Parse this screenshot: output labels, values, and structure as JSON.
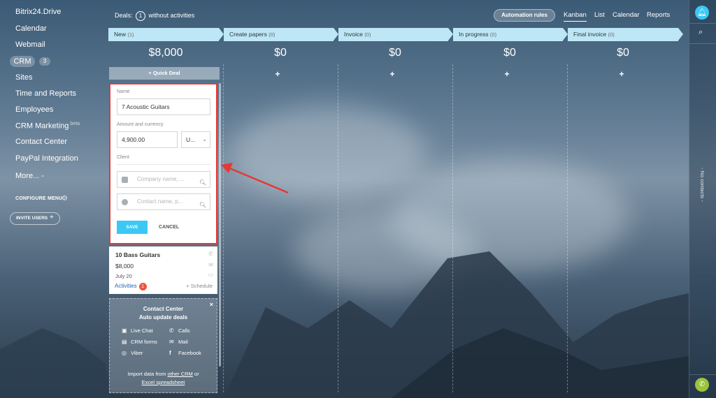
{
  "sidebar": {
    "items": [
      "Bitrix24.Drive",
      "Calendar",
      "Webmail",
      "Sites",
      "Time and Reports",
      "Employees",
      "CRM Marketing",
      "Contact Center",
      "PayPal Integration",
      "More... -"
    ],
    "crm_label": "CRM",
    "crm_count": "3",
    "beta_label": "beta",
    "configure_menu": "CONFIGURE MENU",
    "invite_users": "INVITE USERS"
  },
  "topbar": {
    "deals_label": "Deals:",
    "deals_count": "1",
    "deals_suffix": "without activities",
    "automation_rules": "Automation rules",
    "views": [
      "Kanban",
      "List",
      "Calendar",
      "Reports"
    ],
    "active_view": "Kanban"
  },
  "columns": [
    {
      "name": "New",
      "count": "(1)",
      "sum": "$8,000"
    },
    {
      "name": "Create papers",
      "count": "(0)",
      "sum": "$0"
    },
    {
      "name": "Invoice",
      "count": "(0)",
      "sum": "$0"
    },
    {
      "name": "In progress",
      "count": "(0)",
      "sum": "$0"
    },
    {
      "name": "Final invoice",
      "count": "(0)",
      "sum": "$0"
    }
  ],
  "quick_deal": "+ Quick Deal",
  "form": {
    "name_label": "Name",
    "name_value": "7 Acoustic Guitars",
    "amount_label": "Amount and currency",
    "amount_value": "4,900.00",
    "currency_value": "U...",
    "client_label": "Client",
    "company_placeholder": "Company name, ...",
    "contact_placeholder": "Contact name, p...",
    "save": "SAVE",
    "cancel": "CANCEL"
  },
  "card": {
    "title": "10 Bass Guitars",
    "sum": "$8,000",
    "date": "July 20",
    "activities": "Activities",
    "activities_count": "1",
    "schedule": "+ Schedule"
  },
  "promo": {
    "title1": "Contact Center",
    "title2": "Auto update deals",
    "items": [
      "Live Chat",
      "Calls",
      "CRM forms",
      "Mail",
      "Viber",
      "Facebook"
    ],
    "import_prefix": "Import data from",
    "import_link1": "other CRM",
    "import_or": "or",
    "import_link2": "Excel spreadsheet",
    "close": "×"
  },
  "right_panel": {
    "no_contacts": "- No contacts -"
  },
  "colors": {
    "accent": "#3bc8f5",
    "stage_header": "#bde7f7",
    "highlight_border": "#e53935",
    "phone": "#9bc33c"
  }
}
